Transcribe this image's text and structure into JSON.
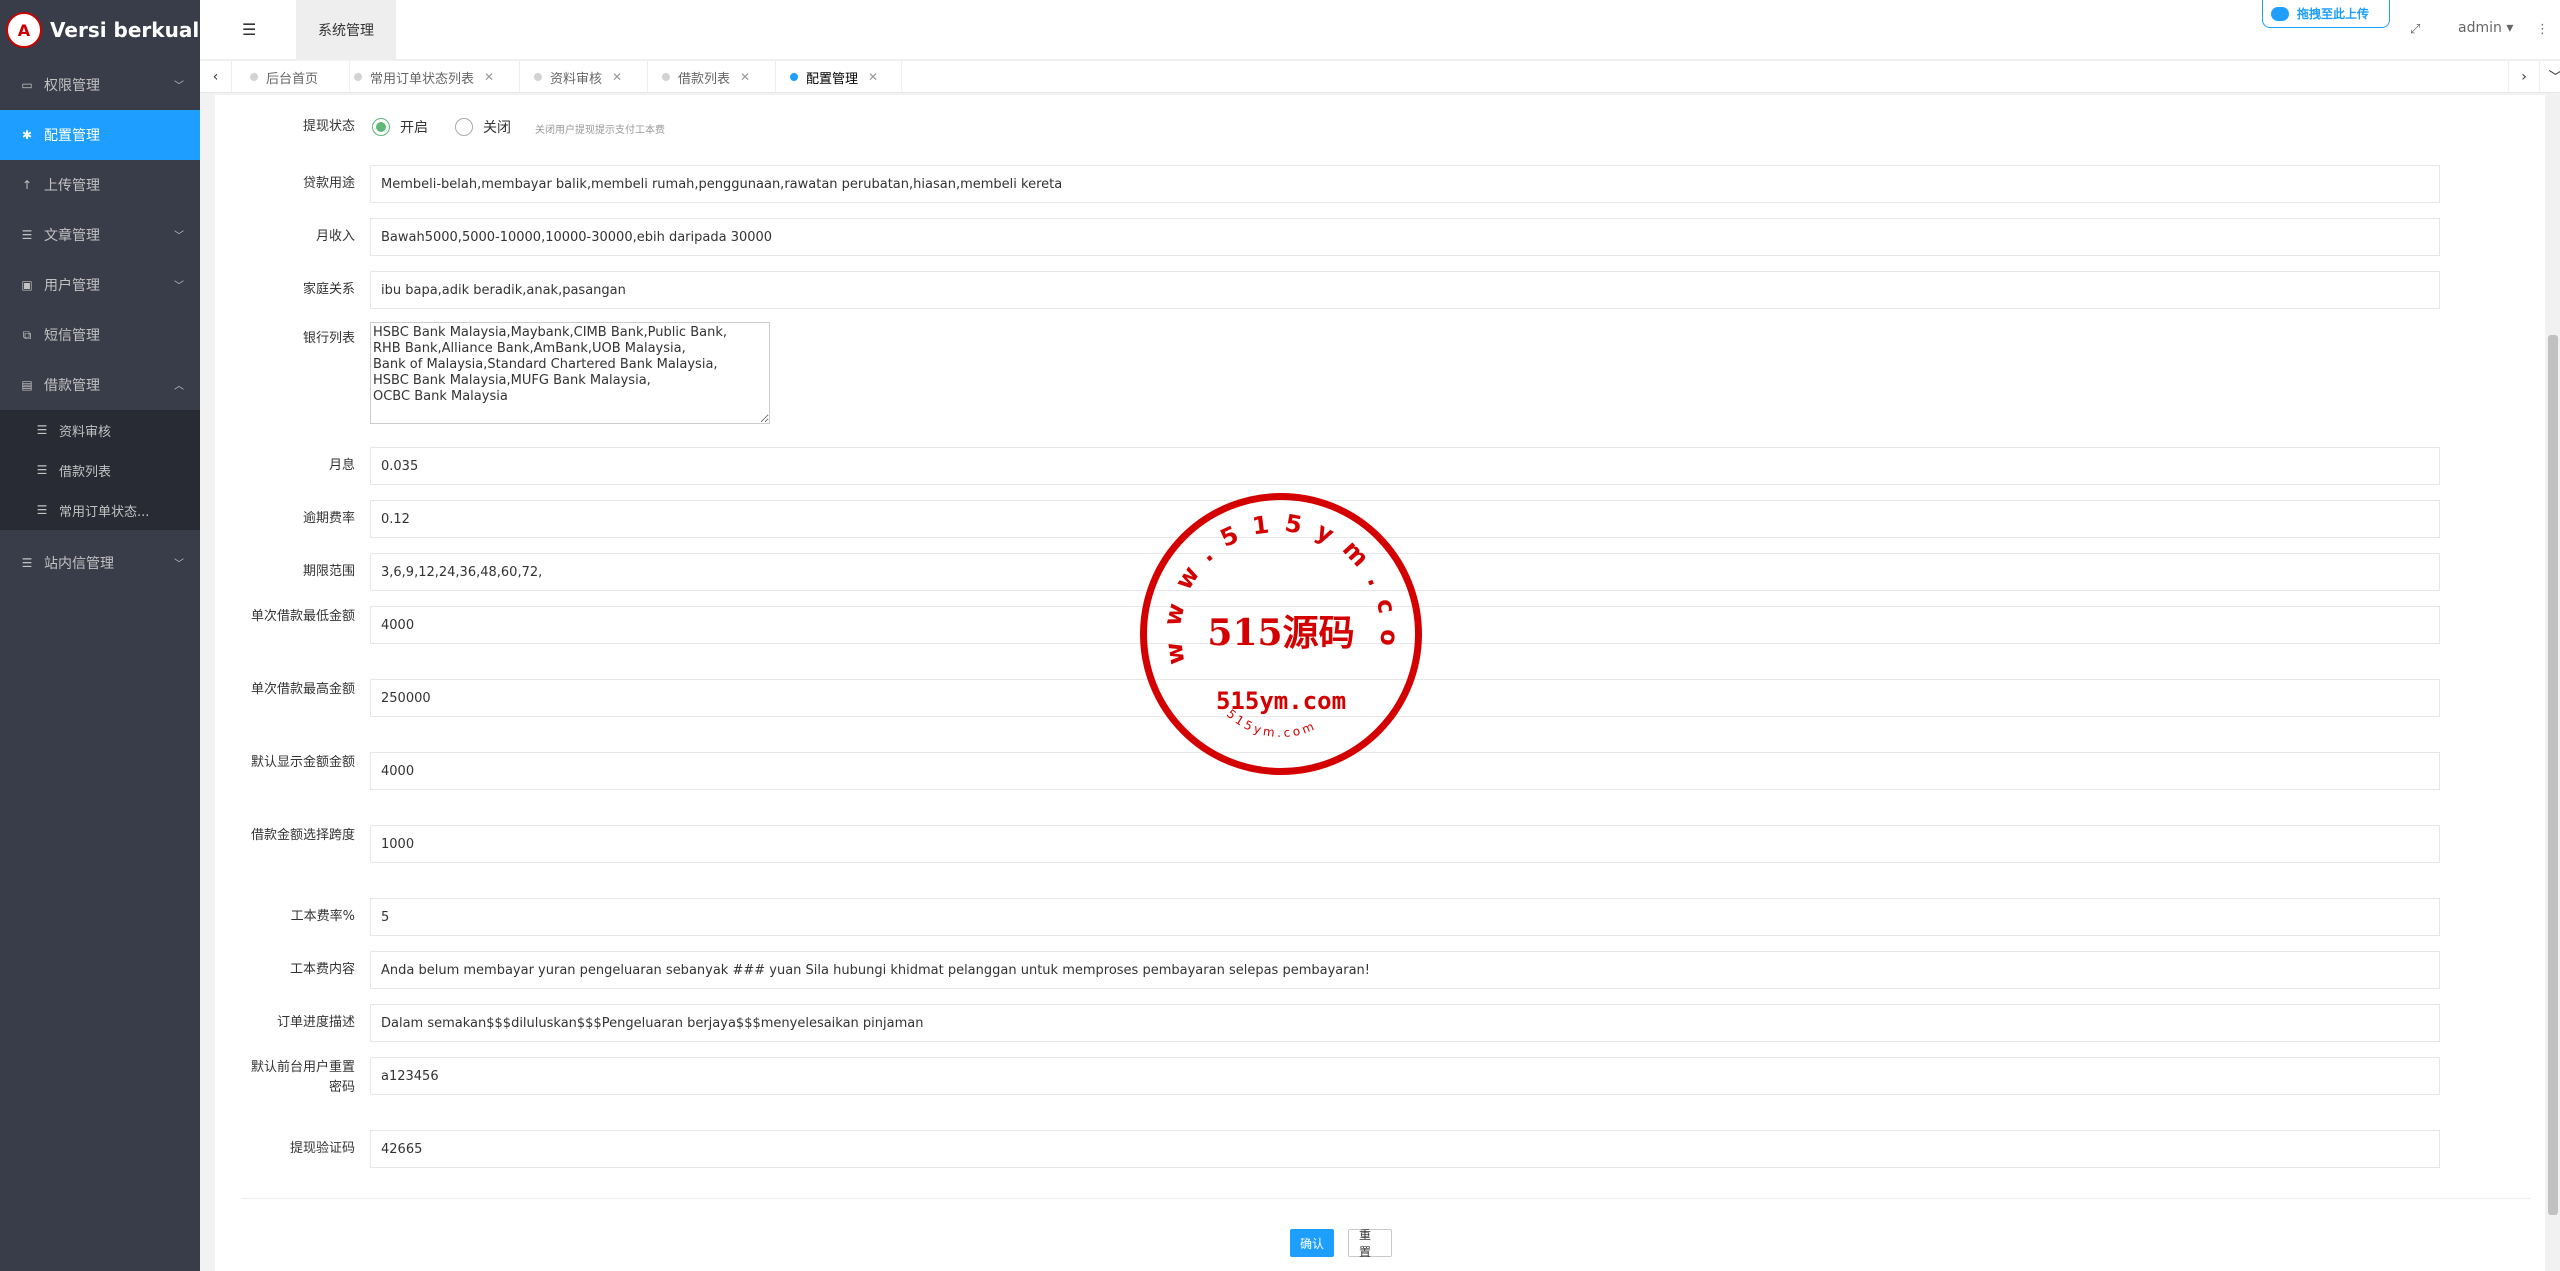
{
  "app": {
    "title": "Versi berkualiti",
    "logo_text": "A"
  },
  "sidebar": {
    "items": [
      {
        "label": "权限管理",
        "icon": "laptop-icon",
        "expandable": true
      },
      {
        "label": "配置管理",
        "icon": "gear-icon",
        "active": true
      },
      {
        "label": "上传管理",
        "icon": "arrow-up-icon"
      },
      {
        "label": "文章管理",
        "icon": "list-icon",
        "expandable": true
      },
      {
        "label": "用户管理",
        "icon": "user-card-icon",
        "expandable": true
      },
      {
        "label": "短信管理",
        "icon": "copy-icon"
      },
      {
        "label": "借款管理",
        "icon": "money-icon",
        "expanded": true
      }
    ],
    "subitems": [
      {
        "label": "资料审核",
        "icon": "list-icon"
      },
      {
        "label": "借款列表",
        "icon": "list-icon"
      },
      {
        "label": "常用订单状态...",
        "icon": "list-icon"
      }
    ],
    "last_item": {
      "label": "站内信管理",
      "icon": "list-icon",
      "expandable": true
    }
  },
  "header": {
    "tab_label": "系统管理",
    "upload_label": "拖拽至此上传",
    "user": "admin"
  },
  "tabs": [
    {
      "label": "后台首页",
      "closable": false
    },
    {
      "label": "常用订单状态列表",
      "closable": true
    },
    {
      "label": "资料审核",
      "closable": true
    },
    {
      "label": "借款列表",
      "closable": true
    },
    {
      "label": "配置管理",
      "closable": true,
      "active": true
    }
  ],
  "form": {
    "withdraw_status": {
      "label": "提现状态",
      "options": [
        "开启",
        "关闭"
      ],
      "selected": "开启",
      "hint": "关闭用户提现提示支付工本费"
    },
    "fields": [
      {
        "label": "贷款用途",
        "value": "Membeli-belah,membayar balik,membeli rumah,penggunaan,rawatan perubatan,hiasan,membeli kereta"
      },
      {
        "label": "月收入",
        "value": "Bawah5000,5000-10000,10000-30000,ebih daripada 30000"
      },
      {
        "label": "家庭关系",
        "value": "ibu bapa,adik beradik,anak,pasangan"
      }
    ],
    "bank_list": {
      "label": "银行列表",
      "value": "HSBC Bank Malaysia,Maybank,CIMB Bank,Public Bank,\nRHB Bank,Alliance Bank,AmBank,UOB Malaysia,\nBank of Malaysia,Standard Chartered Bank Malaysia,\nHSBC Bank Malaysia,MUFG Bank Malaysia,\nOCBC Bank Malaysia"
    },
    "fields2": [
      {
        "label": "月息",
        "value": "0.035"
      },
      {
        "label": "逾期费率",
        "value": "0.12"
      },
      {
        "label": "期限范围",
        "value": "3,6,9,12,24,36,48,60,72,"
      },
      {
        "label": "单次借款最低金额",
        "value": "4000"
      },
      {
        "label": "单次借款最高金额",
        "value": "250000"
      },
      {
        "label": "默认显示金额金额",
        "value": "4000"
      },
      {
        "label": "借款金额选择跨度",
        "value": "1000"
      },
      {
        "label": "工本费率%",
        "value": "5"
      },
      {
        "label": "工本费内容",
        "value": "Anda belum membayar yuran pengeluaran sebanyak ### yuan Sila hubungi khidmat pelanggan untuk memproses pembayaran selepas pembayaran!"
      },
      {
        "label": "订单进度描述",
        "value": "Dalam semakan$$$diluluskan$$$Pengeluaran berjaya$$$menyelesaikan pinjaman"
      },
      {
        "label": "默认前台用户重置密码",
        "value": "a123456"
      },
      {
        "label": "提现验证码",
        "value": "42665"
      }
    ],
    "submit_label": "确认",
    "reset_label": "重置"
  },
  "watermark": {
    "ring_text": "www.515ym.com",
    "center_text": "515源码",
    "domain_text": "515ym.com",
    "bottom_text": "515ym.com",
    "color": "#d40000"
  },
  "colors": {
    "accent": "#1e9fff",
    "sidebar_bg": "#393d49",
    "subnav_bg": "#282b33",
    "radio_on": "#5fb878"
  }
}
